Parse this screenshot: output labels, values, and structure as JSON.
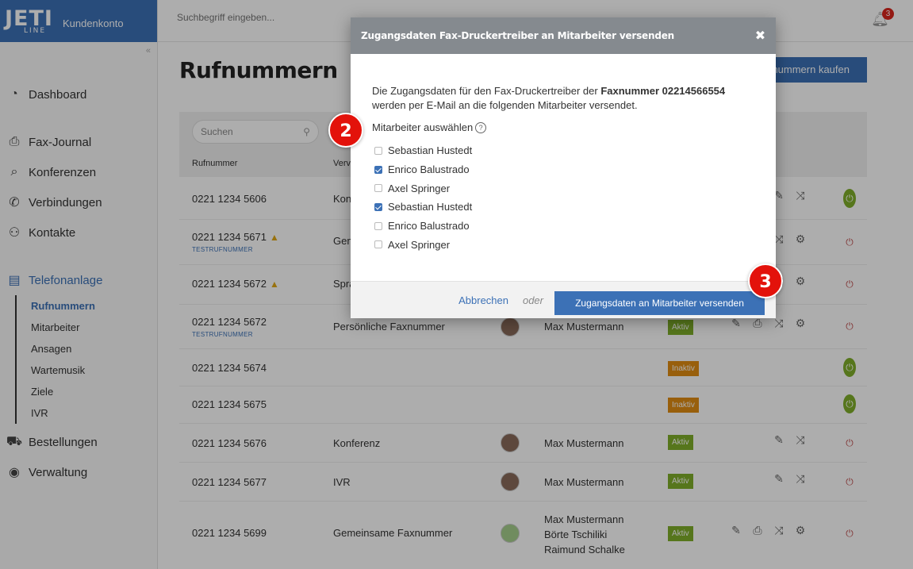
{
  "brand": {
    "logo": "JETI",
    "logo_sub": "LINE",
    "title": "Kundenkonto"
  },
  "topbar": {
    "search_placeholder": "Suchbegriff eingeben...",
    "notifications": "3"
  },
  "nav": {
    "items": [
      {
        "label": "Dashboard",
        "icon": "speedometer-icon"
      },
      {
        "label": "Fax-Journal",
        "icon": "fax-icon"
      },
      {
        "label": "Konferenzen",
        "icon": "conference-icon"
      },
      {
        "label": "Verbindungen",
        "icon": "phone-icon"
      },
      {
        "label": "Kontakte",
        "icon": "contacts-icon"
      },
      {
        "label": "Telefonanlage",
        "icon": "phone-system-icon"
      }
    ],
    "sub": [
      "Rufnummern",
      "Mitarbeiter",
      "Ansagen",
      "Wartemusik",
      "Ziele",
      "IVR"
    ],
    "bottom": [
      {
        "label": "Bestellungen",
        "icon": "cart-icon"
      },
      {
        "label": "Verwaltung",
        "icon": "user-circle-icon"
      }
    ]
  },
  "main": {
    "title": "Rufnummern",
    "buy_button": "nummern kaufen",
    "search_placeholder": "Suchen",
    "columns": {
      "number": "Rufnummer",
      "use": "Verv"
    },
    "rows": [
      {
        "number": "0221 1234 5606",
        "tag": "",
        "use": "Kon",
        "users": [],
        "status": "",
        "power": "green"
      },
      {
        "number": "0221 1234 5671",
        "tag": "TESTRUFNUMMER",
        "use": "Gem",
        "users": [],
        "status": "",
        "power": "red",
        "warn": true
      },
      {
        "number": "0221 1234 5672",
        "tag": "",
        "use": "Spra",
        "users": [],
        "status": "",
        "power": "red",
        "warn": true
      },
      {
        "number": "0221 1234 5672",
        "tag": "TESTRUFNUMMER",
        "use": "Persönliche Faxnummer",
        "users": [
          "Max Mustermann"
        ],
        "status": "Aktiv",
        "power": "red"
      },
      {
        "number": "0221 1234 5674",
        "tag": "",
        "use": "",
        "users": [],
        "status": "Inaktiv",
        "power": "green"
      },
      {
        "number": "0221 1234 5675",
        "tag": "",
        "use": "",
        "users": [],
        "status": "Inaktiv",
        "power": "green"
      },
      {
        "number": "0221 1234 5676",
        "tag": "",
        "use": "Konferenz",
        "users": [
          "Max Mustermann"
        ],
        "status": "Aktiv",
        "power": "red"
      },
      {
        "number": "0221 1234 5677",
        "tag": "",
        "use": "IVR",
        "users": [
          "Max Mustermann"
        ],
        "status": "Aktiv",
        "power": "red"
      },
      {
        "number": "0221 1234 5699",
        "tag": "",
        "use": "Gemeinsame Faxnummer",
        "users": [
          "Max Mustermann",
          "Börte Tschiliki",
          "Raimund Schalke"
        ],
        "status": "Aktiv",
        "power": "red"
      }
    ]
  },
  "modal": {
    "title": "Zugangsdaten Fax-Druckertreiber an Mitarbeiter versenden",
    "intro_pre": "Die Zugangsdaten für den Fax-Druckertreiber der ",
    "intro_bold": "Faxnummer 02214566554",
    "intro_post": "werden per E-Mail an die folgenden Mitarbeiter versendet.",
    "select_label": "Mitarbeiter auswählen",
    "employees": [
      {
        "name": "Sebastian Hustedt",
        "checked": false
      },
      {
        "name": "Enrico Balustrado",
        "checked": true
      },
      {
        "name": "Axel Springer",
        "checked": false
      },
      {
        "name": "Sebastian Hustedt",
        "checked": true
      },
      {
        "name": "Enrico Balustrado",
        "checked": false
      },
      {
        "name": "Axel Springer",
        "checked": false
      }
    ],
    "cancel": "Abbrechen",
    "or": "oder",
    "send": "Zugangsdaten an Mitarbeiter versenden"
  },
  "steps": [
    "2",
    "3"
  ]
}
